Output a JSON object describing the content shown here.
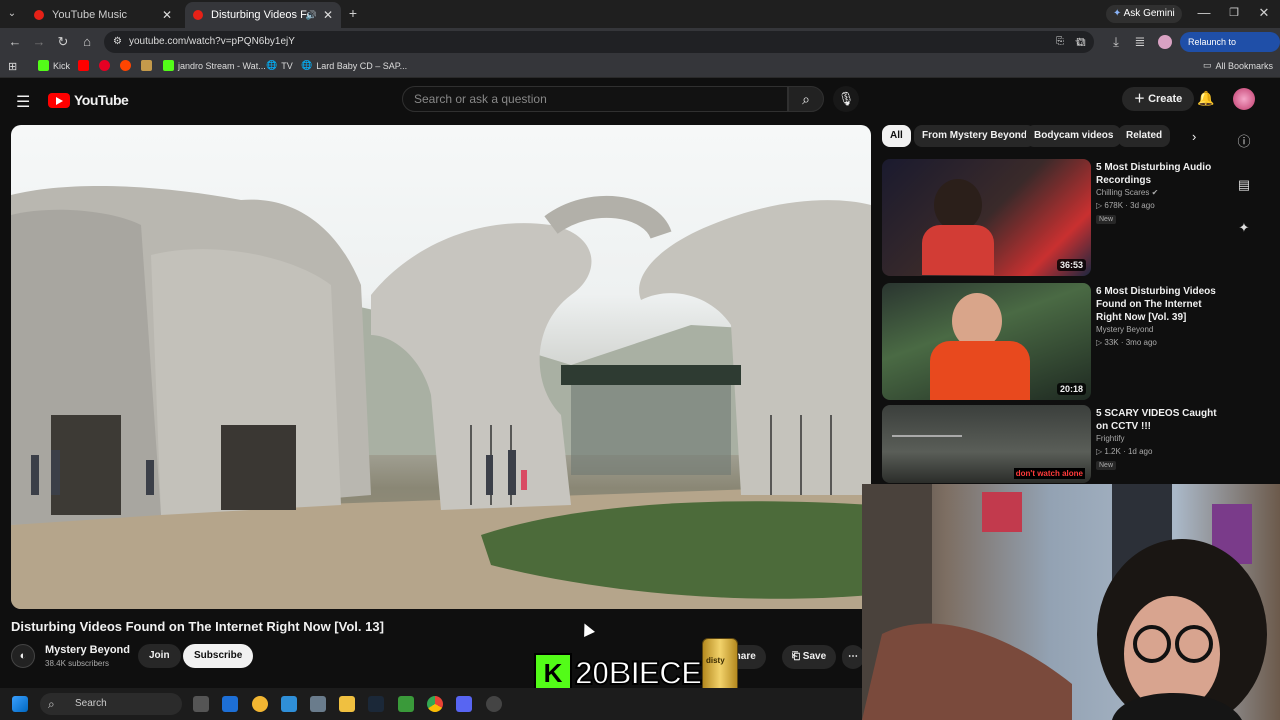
{
  "browser": {
    "tabs": [
      {
        "label": "YouTube Music",
        "active": false
      },
      {
        "label": "Disturbing Videos Found o",
        "active": true
      }
    ],
    "new_tab": "+",
    "url": "youtube.com/watch?v=pPQN6by1ejY",
    "ask_gemini": "Ask Gemini",
    "relaunch": "Relaunch to update",
    "bookmarks": [
      "Kick",
      "jandro Stream - Wat...",
      "TV",
      "Lard Baby CD – SAP..."
    ],
    "all_bookmarks": "All Bookmarks"
  },
  "youtube": {
    "logo_text": "YouTube",
    "search_placeholder": "Search or ask a question",
    "create_label": "Create",
    "video": {
      "title": "Disturbing Videos Found on The Internet Right Now [Vol. 13]",
      "channel": "Mystery Beyond",
      "subscribers": "38.4K subscribers",
      "join": "Join",
      "subscribe": "Subscribe",
      "share": "Share",
      "save": "Save"
    },
    "chips": [
      "All",
      "From Mystery Beyond",
      "Bodycam videos",
      "Related"
    ],
    "recommendations": [
      {
        "title": "5 Most Disturbing Audio Recordings",
        "channel": "Chilling Scares",
        "views": "678K",
        "age": "3d ago",
        "badge": "New",
        "duration": "36:53"
      },
      {
        "title": "6 Most Disturbing Videos Found on The Internet Right Now [Vol. 39]",
        "channel": "Mystery Beyond",
        "views": "33K",
        "age": "3mo ago",
        "badge": "",
        "duration": "20:18"
      },
      {
        "title": "5 SCARY VIDEOS Caught on CCTV !!!",
        "channel": "Frightify",
        "views": "1.2K",
        "age": "1d ago",
        "badge": "New",
        "duration": "",
        "thumb_caption": "don't watch alone"
      }
    ]
  },
  "overlay": {
    "kick_badge": "K",
    "kick_name": "20BIECE",
    "can_label": "disty"
  },
  "taskbar": {
    "search": "Search"
  },
  "colors": {
    "youtube_red": "#ff0000",
    "kick_green": "#53fc18",
    "relaunch_blue": "#1f4fa8"
  }
}
